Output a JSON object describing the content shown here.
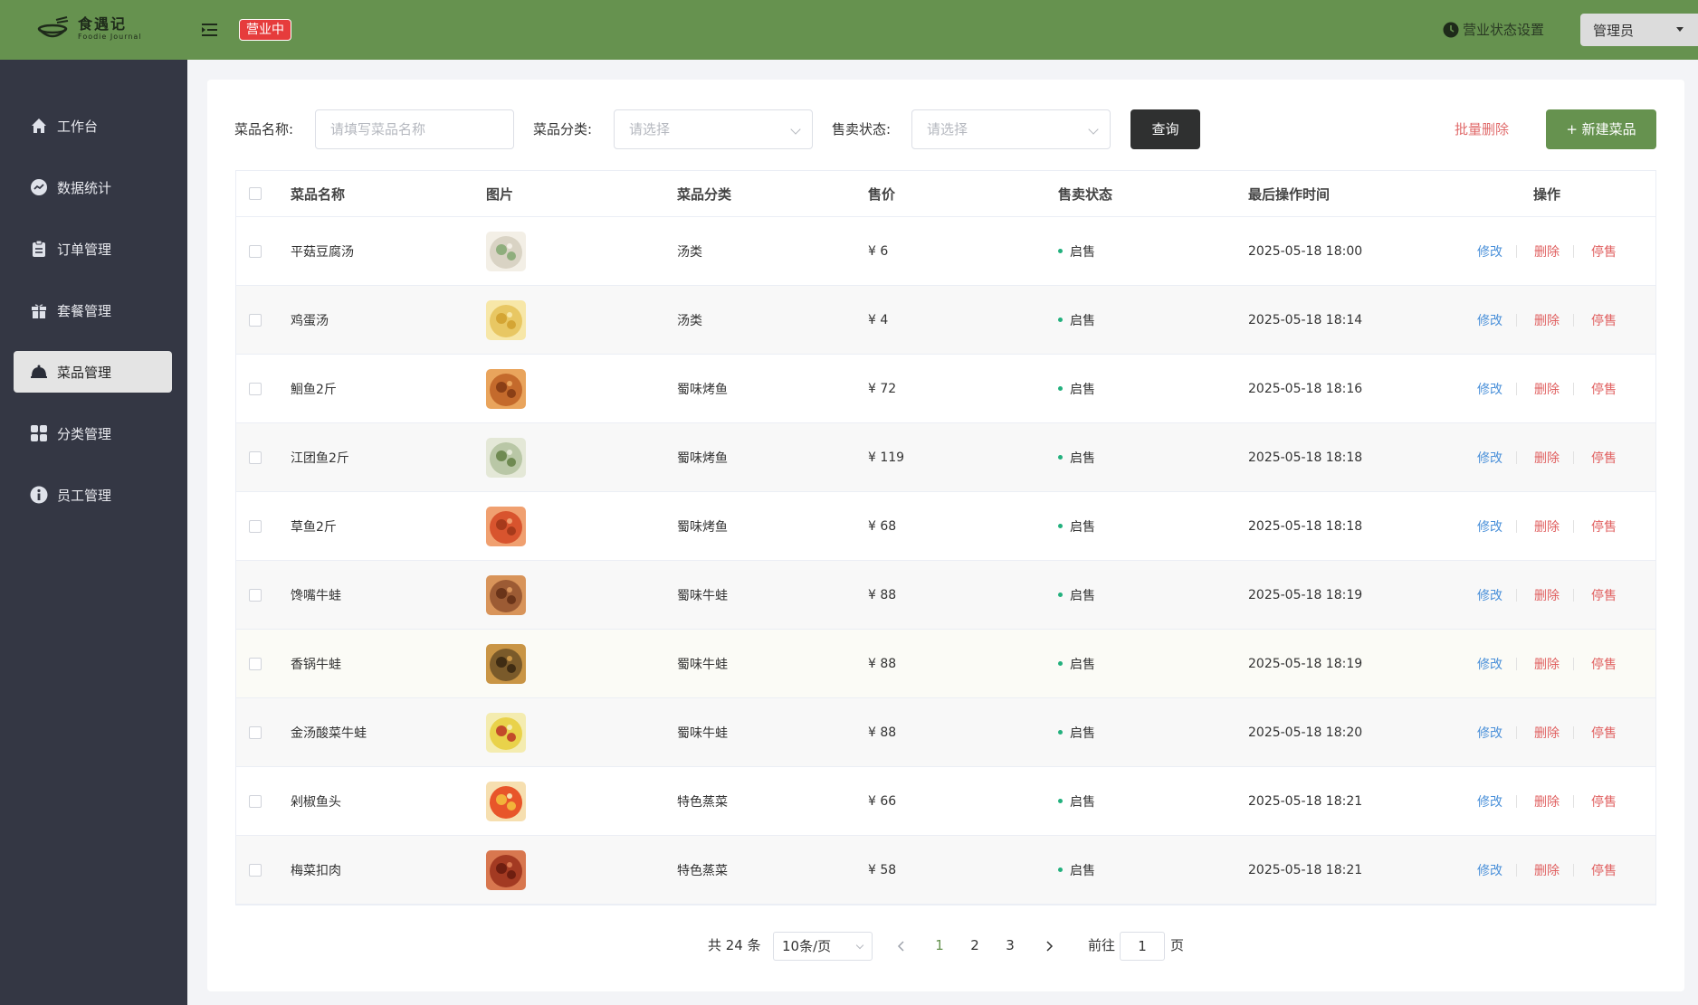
{
  "header": {
    "logo_cn": "食遇记",
    "logo_en": "Foodie Journal",
    "status_tag": "营业中",
    "biz_setting": "营业状态设置",
    "user": "管理员"
  },
  "sidebar": {
    "items": [
      {
        "label": "工作台",
        "icon": "home-icon"
      },
      {
        "label": "数据统计",
        "icon": "chart-icon"
      },
      {
        "label": "订单管理",
        "icon": "clipboard-icon"
      },
      {
        "label": "套餐管理",
        "icon": "gift-icon"
      },
      {
        "label": "菜品管理",
        "icon": "cloche-icon",
        "active": true
      },
      {
        "label": "分类管理",
        "icon": "grid-icon"
      },
      {
        "label": "员工管理",
        "icon": "info-icon"
      }
    ]
  },
  "filters": {
    "name_label": "菜品名称:",
    "name_placeholder": "请填写菜品名称",
    "category_label": "菜品分类:",
    "category_placeholder": "请选择",
    "status_label": "售卖状态:",
    "status_placeholder": "请选择",
    "query_button": "查询",
    "batch_delete": "批量删除",
    "new_button": "+ 新建菜品"
  },
  "table": {
    "columns": [
      "菜品名称",
      "图片",
      "菜品分类",
      "售价",
      "售卖状态",
      "最后操作时间",
      "操作"
    ],
    "ops": {
      "edit": "修改",
      "delete": "删除",
      "stop": "停售"
    },
    "rows": [
      {
        "name": "平菇豆腐汤",
        "category": "汤类",
        "price": "¥ 6",
        "status": "启售",
        "time": "2025-05-18 18:00"
      },
      {
        "name": "鸡蛋汤",
        "category": "汤类",
        "price": "¥ 4",
        "status": "启售",
        "time": "2025-05-18 18:14"
      },
      {
        "name": "鮰鱼2斤",
        "category": "蜀味烤鱼",
        "price": "¥ 72",
        "status": "启售",
        "time": "2025-05-18 18:16"
      },
      {
        "name": "江团鱼2斤",
        "category": "蜀味烤鱼",
        "price": "¥ 119",
        "status": "启售",
        "time": "2025-05-18 18:18"
      },
      {
        "name": "草鱼2斤",
        "category": "蜀味烤鱼",
        "price": "¥ 68",
        "status": "启售",
        "time": "2025-05-18 18:18"
      },
      {
        "name": "馋嘴牛蛙",
        "category": "蜀味牛蛙",
        "price": "¥ 88",
        "status": "启售",
        "time": "2025-05-18 18:19"
      },
      {
        "name": "香锅牛蛙",
        "category": "蜀味牛蛙",
        "price": "¥ 88",
        "status": "启售",
        "time": "2025-05-18 18:19"
      },
      {
        "name": "金汤酸菜牛蛙",
        "category": "蜀味牛蛙",
        "price": "¥ 88",
        "status": "启售",
        "time": "2025-05-18 18:20"
      },
      {
        "name": "剁椒鱼头",
        "category": "特色蒸菜",
        "price": "¥ 66",
        "status": "启售",
        "time": "2025-05-18 18:21"
      },
      {
        "name": "梅菜扣肉",
        "category": "特色蒸菜",
        "price": "¥ 58",
        "status": "启售",
        "time": "2025-05-18 18:21"
      }
    ]
  },
  "pagination": {
    "total": "共 24 条",
    "page_size": "10条/页",
    "pages": [
      "1",
      "2",
      "3"
    ],
    "current": "1",
    "goto_prefix": "前往",
    "goto_value": "1",
    "goto_suffix": "页"
  },
  "colors": {
    "brand": "#66924f",
    "sidebar": "#343744",
    "status_dot": "#22b07d",
    "danger": "#e06060",
    "link": "#4a90d9"
  }
}
